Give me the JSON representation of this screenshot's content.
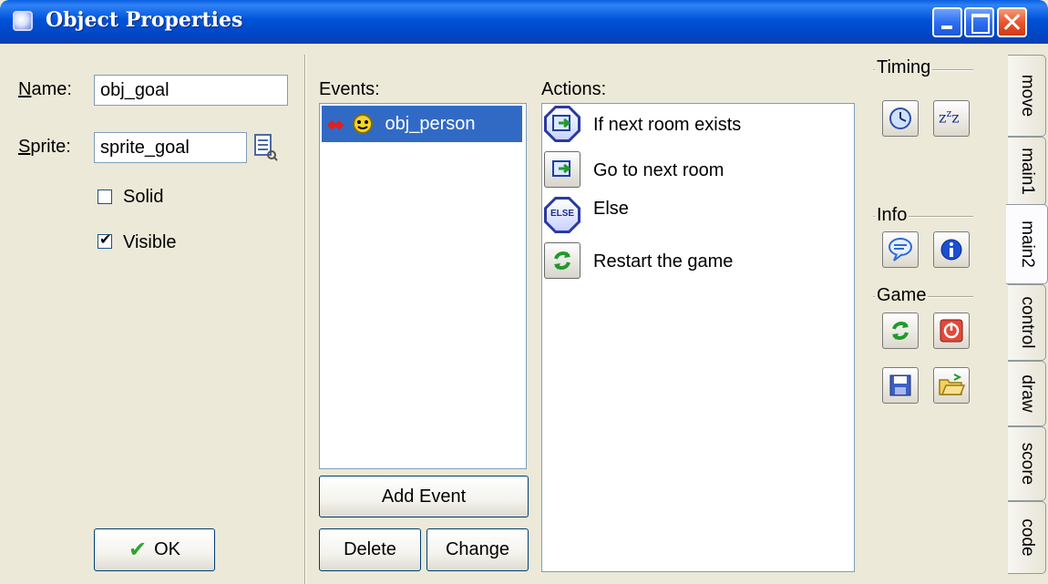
{
  "window": {
    "title": "Object Properties"
  },
  "properties": {
    "name_label": "Name:",
    "name_value": "obj_goal",
    "sprite_label": "Sprite:",
    "sprite_value": "sprite_goal",
    "solid_label": "Solid",
    "solid_checked": false,
    "visible_label": "Visible",
    "visible_checked": true,
    "ok_label": "OK"
  },
  "events": {
    "header": "Events:",
    "items": [
      {
        "label": "obj_person",
        "selected": true
      }
    ],
    "add_label": "Add Event",
    "delete_label": "Delete",
    "change_label": "Change"
  },
  "actions": {
    "header": "Actions:",
    "items": [
      {
        "label": "If next room exists",
        "icon": "next-room-question-icon"
      },
      {
        "label": "Go to next room",
        "icon": "next-room-icon"
      },
      {
        "label": "Else",
        "icon": "else-icon"
      },
      {
        "label": "Restart the game",
        "icon": "restart-icon"
      }
    ]
  },
  "palette": {
    "timing_label": "Timing",
    "info_label": "Info",
    "game_label": "Game"
  },
  "tabs": [
    {
      "label": "move",
      "active": false
    },
    {
      "label": "main1",
      "active": false
    },
    {
      "label": "main2",
      "active": true
    },
    {
      "label": "control",
      "active": false
    },
    {
      "label": "draw",
      "active": false
    },
    {
      "label": "score",
      "active": false
    },
    {
      "label": "code",
      "active": false
    }
  ],
  "colors": {
    "title_bar": "#0052d8",
    "selection": "#316ac5",
    "face": "#ece9d8"
  }
}
